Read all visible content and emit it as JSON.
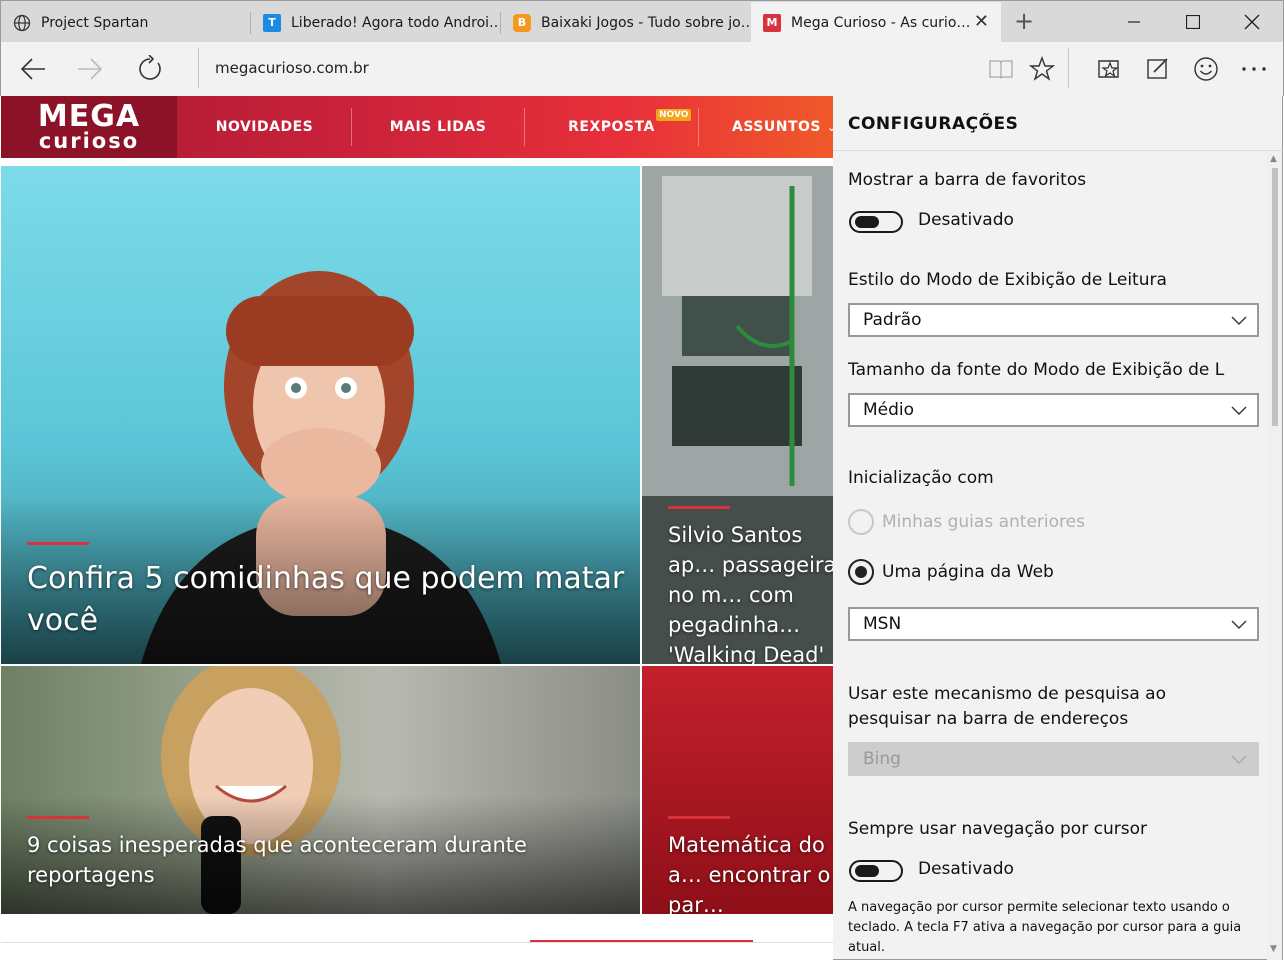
{
  "tabs": [
    {
      "label": "Project Spartan",
      "icon": "globe-icon"
    },
    {
      "label": "Liberado! Agora todo Androi…",
      "icon": "tecmundo-icon"
    },
    {
      "label": "Baixaki Jogos - Tudo sobre jo…",
      "icon": "baixaki-icon"
    },
    {
      "label": "Mega Curioso - As curio…",
      "icon": "megacurioso-icon",
      "active": true
    }
  ],
  "address": "megacurioso.com.br",
  "site": {
    "logo_line1": "MEGA",
    "logo_line2": "curioso",
    "menu": [
      "NOVIDADES",
      "MAIS LIDAS",
      "REXPOSTA",
      "ASSUNTOS"
    ],
    "badge": "NOVO",
    "articles": [
      {
        "title": "Confira 5 comidinhas que podem matar você"
      },
      {
        "title": "Silvio Santos ap… passageiras no m… com pegadinha… 'Walking Dead'"
      },
      {
        "title": "9 coisas inesperadas que aconteceram durante reportagens"
      },
      {
        "title": "Matemática do a… encontrar o par…"
      }
    ]
  },
  "settings": {
    "title": "CONFIGURAÇÕES",
    "favorites_bar_label": "Mostrar a barra de favoritos",
    "favorites_bar_state": "Desativado",
    "reading_style_label": "Estilo do Modo de Exibição de Leitura",
    "reading_style_value": "Padrão",
    "reading_font_label": "Tamanho da fonte do Modo de Exibição de L",
    "reading_font_value": "Médio",
    "startup_label": "Inicialização com",
    "startup_option1": "Minhas guias anteriores",
    "startup_option2": "Uma página da Web",
    "startup_page_value": "MSN",
    "search_engine_label_line1": "Usar este mecanismo de pesquisa ao",
    "search_engine_label_line2": "pesquisar na barra de endereços",
    "search_engine_value": "Bing",
    "caret_label": "Sempre usar navegação por cursor",
    "caret_state": "Desativado",
    "caret_help": "A navegação por cursor permite selecionar texto usando o teclado. A tecla F7 ativa a navegação por cursor para a guia atual."
  },
  "colors": {
    "accent_red": "#d8323c",
    "header_dark": "#8c1227",
    "pane_bg": "#f2f2f2"
  }
}
